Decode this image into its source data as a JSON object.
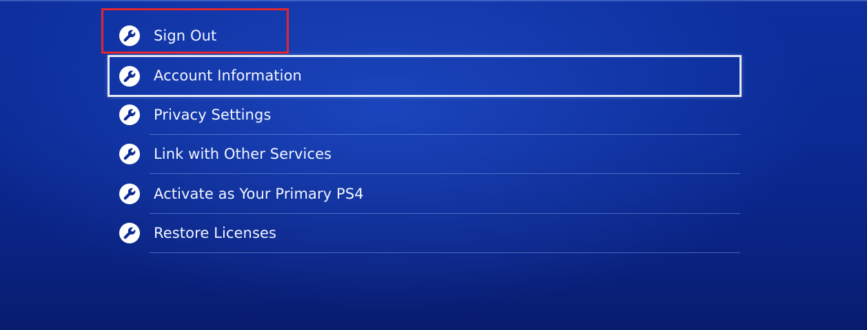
{
  "menu": {
    "items": [
      {
        "label": "Sign Out",
        "icon": "wrench-icon"
      },
      {
        "label": "Account Information",
        "icon": "wrench-icon"
      },
      {
        "label": "Privacy Settings",
        "icon": "wrench-icon"
      },
      {
        "label": "Link with Other Services",
        "icon": "wrench-icon"
      },
      {
        "label": "Activate as Your Primary PS4",
        "icon": "wrench-icon"
      },
      {
        "label": "Restore Licenses",
        "icon": "wrench-icon"
      }
    ],
    "focused_label": "Account Information",
    "highlighted_label": "Sign Out"
  },
  "colors": {
    "background": "#0b2a94",
    "text": "#f3f6ff",
    "focus_border": "#e6ecf7",
    "annotation": "#e3262d"
  }
}
